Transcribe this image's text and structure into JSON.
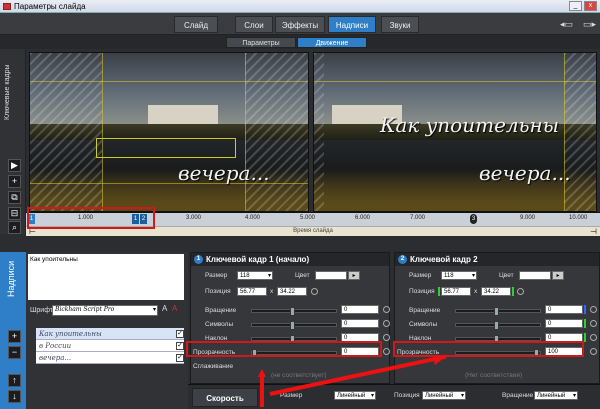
{
  "window": {
    "title": "Параметры слайда"
  },
  "tabs": [
    {
      "label": "Слайд"
    },
    {
      "label": "Слои"
    },
    {
      "label": "Эффекты"
    },
    {
      "label": "Надписи"
    },
    {
      "label": "Звуки"
    }
  ],
  "subtabs": [
    {
      "label": "Параметры"
    },
    {
      "label": "Движение"
    }
  ],
  "left_sidebar": {
    "label": "Ключевые кадры"
  },
  "preview": {
    "script_line1": "Как упоительны",
    "script_line2": "вечера..."
  },
  "timeline": {
    "ticks": [
      "1.000",
      "2.000",
      "3.000",
      "4.000",
      "5.000",
      "6.000",
      "7.000",
      "8.000",
      "9.000",
      "10.000"
    ],
    "marker_left": "1",
    "marker_mid1": "1",
    "marker_mid2": "2",
    "marker_right": "3",
    "caption": "Время слайда"
  },
  "captions_panel": {
    "label": "Надписи",
    "text_preview": "Как упоительны",
    "font_label": "Шрифт",
    "font_name": "Bickham Script Pro",
    "rows": [
      "Как упоительны",
      "в России",
      "вечера..."
    ]
  },
  "keyframe1": {
    "title": "Ключевой кадр 1 (начало)",
    "size_label": "Размер",
    "size_value": "118",
    "color_label": "Цвет",
    "position_label": "Позиция",
    "pos_x": "56.77",
    "pos_y": "34.22",
    "rotation_label": "Вращение",
    "rotation_value": "0",
    "symbols_label": "Символы",
    "symbols_value": "0",
    "tilt_label": "Наклон",
    "tilt_value": "0",
    "opacity_label": "Прозрачность",
    "opacity_value": "0",
    "smooth_label": "Сглаживание",
    "smooth_value": "(не соответствует)"
  },
  "keyframe2": {
    "title": "Ключевой кадр 2",
    "size_label": "Размер",
    "size_value": "118",
    "color_label": "Цвет",
    "position_label": "Позиция",
    "pos_x": "56.77",
    "pos_y": "34.22",
    "rotation_label": "Вращение",
    "rotation_value": "0",
    "symbols_label": "Символы",
    "symbols_value": "0",
    "tilt_label": "Наклон",
    "tilt_value": "0",
    "opacity_label": "Прозрачность",
    "opacity_value": "100",
    "smooth_value": "(Нет соответствия)"
  },
  "bottom": {
    "speed_label": "Скорость",
    "size_label": "Размер",
    "size_mode": "Линейный",
    "position_label": "Позиция",
    "position_mode": "Линейный",
    "rotation_label": "Вращение",
    "rotation_mode": "Линейный"
  },
  "colors": {
    "accent": "#2f7fc8",
    "highlight": "#d21919"
  }
}
